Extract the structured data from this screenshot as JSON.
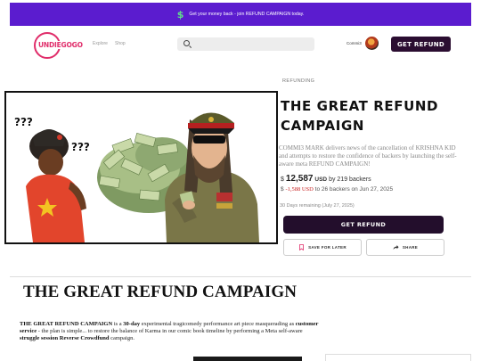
{
  "banner": {
    "icon": "dollar-icon",
    "text": "Get your money back - join REFUND CAMPAIGN today."
  },
  "header": {
    "logo": "UNDIEGOGO",
    "nav": [
      "Explore",
      "Shop"
    ],
    "search_placeholder": "",
    "user_name": "Commi3",
    "get_refund_label": "GET REFUND"
  },
  "hero_image": {
    "caption_left": "???",
    "caption_right": "???"
  },
  "campaign": {
    "category": "REFUNDING",
    "title": "THE GREAT REFUND CAMPAIGN",
    "blurb": "COMMI3 MARK delivers news of the cancellation of KRISHNA KID and attempts to restore the confidence of backers by launching the self-aware meta REFUND CAMPAIGN!",
    "raised_symbol": "$",
    "raised_amount": "12,587",
    "raised_currency": "USD",
    "raised_by": "by 219 backers",
    "compare_symbol": "$",
    "compare_amount": "-1,588 USD",
    "compare_text": "to 26 backers on Jun 27, 2025",
    "days_remaining": "30 Days remaining (July 27, 2025)",
    "refund_button": "GET REFUND",
    "save_button": "SAVE FOR LATER",
    "share_button": "SHARE"
  },
  "story": {
    "heading": "THE GREAT REFUND CAMPAIGN",
    "p_title": "THE GREAT REFUND CAMPAIGN",
    "p_is": " is a ",
    "p_days": "30-day",
    "p_mid": " experimental tragicomedy performance art piece masquerading as ",
    "p_cs": "customer service",
    "p_rest": " - the plan is simple...  to restore the balance of Karma in our comic book timeline by performing a Meta self-aware ",
    "p_ss": "struggle session Reverse Crowdfund",
    "p_end": " campaign."
  },
  "colors": {
    "banner": "#5b1ccf",
    "brand": "#e02d6a",
    "button": "#230e2c",
    "negative": "#c82424"
  }
}
